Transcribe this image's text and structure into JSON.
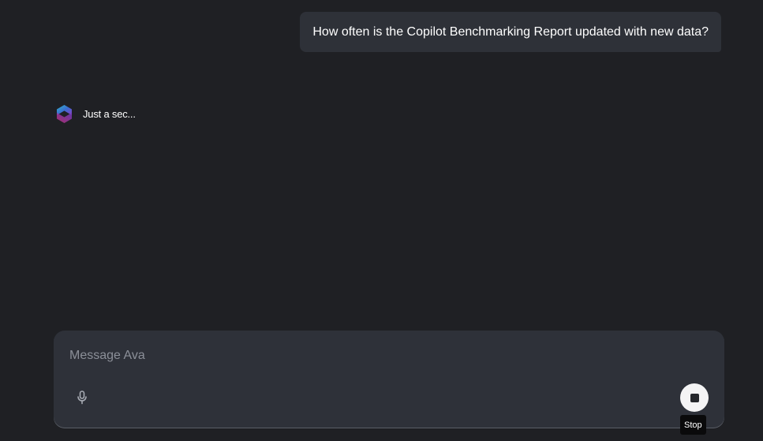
{
  "conversation": {
    "user_message": "How often is the Copilot Benchmarking Report updated with new data?",
    "assistant_status": "Just a sec..."
  },
  "composer": {
    "placeholder": "Message Ava",
    "value": ""
  },
  "icons": {
    "avatar": "ava-logo-icon",
    "mic": "microphone-icon",
    "stop": "stop-icon"
  },
  "stop_tooltip": "Stop",
  "colors": {
    "background": "#1f2024",
    "bubble": "#2e3138",
    "composer": "#2e3139",
    "stop_button": "#f4f4f5"
  }
}
